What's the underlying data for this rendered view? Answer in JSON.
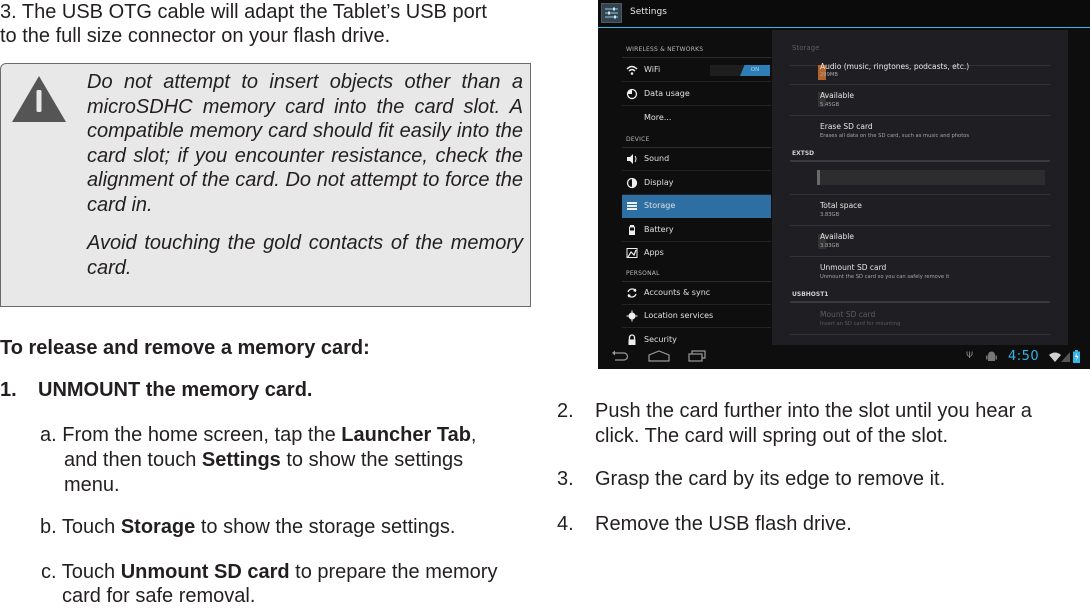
{
  "doc": {
    "intro_step": "3. The USB OTG cable will adapt the Tablet’s USB port to the full size connector on your flash drive.",
    "intro_line1": "3. The USB OTG cable will adapt the Tablet’s USB port",
    "intro_line2": "to the full size connector on your flash drive.",
    "warning": {
      "icon": "warning-triangle-icon",
      "paragraph1": "Do not attempt to insert objects other than a microSDHC memory card into the card slot. A compatible memory card should fit easily into the card slot; if you encounter resistance, check the alignment of the card. Do not attempt to force the card in.",
      "paragraph2": "Avoid touching the gold contacts of the memory card."
    },
    "section_heading": "To release and remove a memory card:",
    "step1": {
      "number": "1.",
      "text": "UNMOUNT the memory card."
    },
    "substeps": [
      {
        "prefix": "a. From the home screen, tap the ",
        "bold1": "Launcher Tab",
        "mid": ",",
        "line2_prefix": "and then touch ",
        "bold2": "Settings",
        "line2_suffix": " to show the settings",
        "line3": "menu."
      },
      {
        "prefix": "b. Touch ",
        "bold": "Storage",
        "suffix": " to show the storage settings."
      },
      {
        "prefix": "c. Touch ",
        "bold": "Unmount SD card",
        "suffix": " to prepare the memory",
        "line2": "card for safe removal."
      }
    ],
    "steps_right": [
      {
        "number": "2.",
        "line1": "Push the card further into the slot until you hear a",
        "line2": "click. The card will spring out of the slot."
      },
      {
        "number": "3.",
        "line1": "Grasp the card by its edge to remove it."
      },
      {
        "number": "4.",
        "line1": "Remove the USB flash drive."
      }
    ]
  },
  "tablet": {
    "app_title": "Settings",
    "accent": "#33b5e5",
    "selected_color": "#2e6fa3",
    "left_pane": {
      "sections": [
        {
          "header": "WIRELESS & NETWORKS",
          "items": [
            {
              "label": "WiFi",
              "icon": "wifi-icon",
              "toggle": "ON"
            },
            {
              "label": "Data usage",
              "icon": "data-usage-icon"
            },
            {
              "label": "More...",
              "icon": ""
            }
          ]
        },
        {
          "header": "DEVICE",
          "items": [
            {
              "label": "Sound",
              "icon": "sound-icon"
            },
            {
              "label": "Display",
              "icon": "display-icon"
            },
            {
              "label": "Storage",
              "icon": "storage-icon",
              "selected": true
            },
            {
              "label": "Battery",
              "icon": "battery-icon"
            },
            {
              "label": "Apps",
              "icon": "apps-icon"
            }
          ]
        },
        {
          "header": "PERSONAL",
          "items": [
            {
              "label": "Accounts & sync",
              "icon": "sync-icon"
            },
            {
              "label": "Location services",
              "icon": "location-icon"
            },
            {
              "label": "Security",
              "icon": "lock-icon"
            }
          ]
        }
      ]
    },
    "right_pane": {
      "title": "Storage",
      "rows": [
        {
          "title": "Audio (music, ringtones, podcasts, etc.)",
          "sub": "299MB",
          "swatch": "#b5652b"
        },
        {
          "title": "Available",
          "sub": "5.45GB",
          "swatch": "#333333"
        },
        {
          "title": "Erase SD card",
          "sub": "Erases all data on the SD card, such as music and photos"
        }
      ],
      "extsd": {
        "header": "EXTSD",
        "usage_fraction": 0.01,
        "rows": [
          {
            "title": "Total space",
            "sub": "3.83GB"
          },
          {
            "title": "Available",
            "sub": "3.83GB",
            "swatch": "#333333"
          },
          {
            "title": "Unmount SD card",
            "sub": "Unmount the SD card so you can safely remove it"
          }
        ]
      },
      "usbhost": {
        "header": "USBHOST1",
        "rows": [
          {
            "title": "Mount SD card",
            "sub": "Insert an SD card for mounting",
            "disabled": true
          }
        ]
      }
    },
    "status_bar": {
      "time": "4:50"
    },
    "nav_buttons": [
      "back-icon",
      "home-icon",
      "recent-apps-icon"
    ]
  }
}
